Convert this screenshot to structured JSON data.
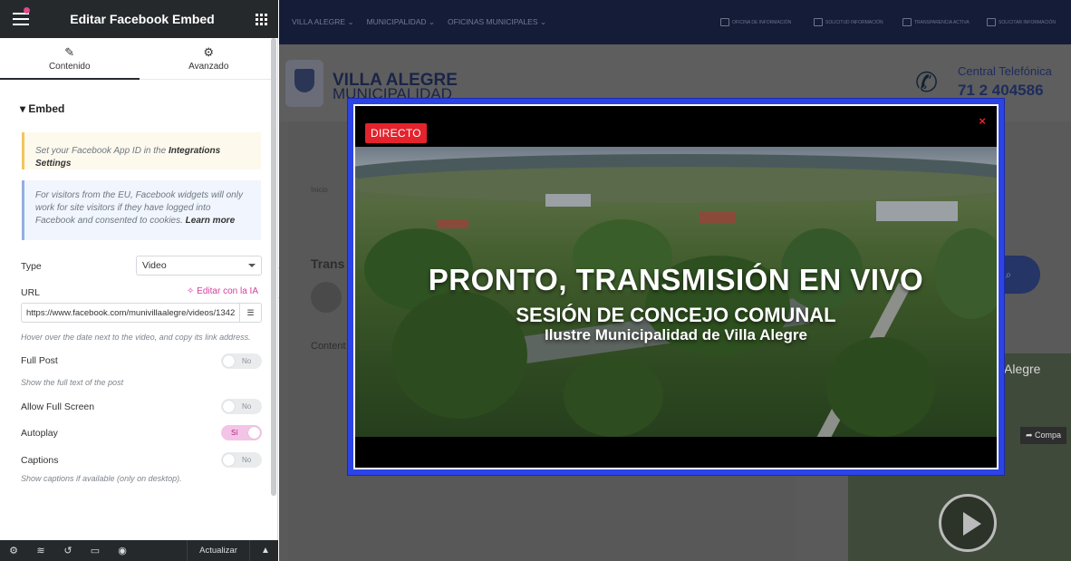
{
  "panel": {
    "title": "Editar Facebook Embed",
    "tabs": [
      {
        "label": "Contenido",
        "icon": "pencil-icon"
      },
      {
        "label": "Avanzado",
        "icon": "gear-icon"
      }
    ],
    "section_title": "Embed",
    "notice_app_id": {
      "text": "Set your Facebook App ID in the ",
      "link": "Integrations Settings"
    },
    "notice_eu": {
      "text": "For visitors from the EU, Facebook widgets will only work for site visitors if they have logged into Facebook and consented to cookies. ",
      "link": "Learn more"
    },
    "type": {
      "label": "Type",
      "value": "Video"
    },
    "url": {
      "label": "URL",
      "ai_link": "Editar con la IA",
      "value": "https://www.facebook.com/munivillaalegre/videos/1342",
      "help": "Hover over the date next to the video, and copy its link address."
    },
    "full_post": {
      "label": "Full Post",
      "state": "No",
      "help": "Show the full text of the post"
    },
    "allow_full_screen": {
      "label": "Allow Full Screen",
      "state": "No"
    },
    "autoplay": {
      "label": "Autoplay",
      "state": "Sí"
    },
    "captions": {
      "label": "Captions",
      "state": "No",
      "help": "Show captions if available (only on desktop)."
    },
    "footer": {
      "save_label": "Actualizar"
    }
  },
  "site": {
    "menu": [
      "VILLA ALEGRE",
      "MUNICIPALIDAD",
      "OFICINAS MUNICIPALES"
    ],
    "top_badges": [
      "OFICINA DE INFORMACIÓN",
      "SOLICITUD INFORMACIÓN",
      "TRANSPARENCIA ACTIVA",
      "SOLICITAR INFORMACIÓN"
    ],
    "brand_line1": "VILLA ALEGRE",
    "brand_line2": "MUNICIPALIDAD",
    "phone_label": "Central Telefónica",
    "phone_number": "71 2 404586",
    "breadcrumb": "Inicio",
    "post_title": "Trans",
    "content_label": "Content",
    "side_card_title": "Alegre",
    "share_label": "Compa"
  },
  "modal": {
    "badge": "DIRECTO",
    "close": "×",
    "video_title": "PRONTO, TRANSMISIÓN EN VIVO",
    "video_sub1": "SESIÓN DE CONCEJO COMUNAL",
    "video_sub2": "Ilustre Municipalidad de Villa Alegre"
  },
  "colors": {
    "modal_border": "#2c43e6",
    "badge": "#e4232c",
    "toggle_on": "#f4c4e6",
    "editor_dark": "#26292c"
  }
}
